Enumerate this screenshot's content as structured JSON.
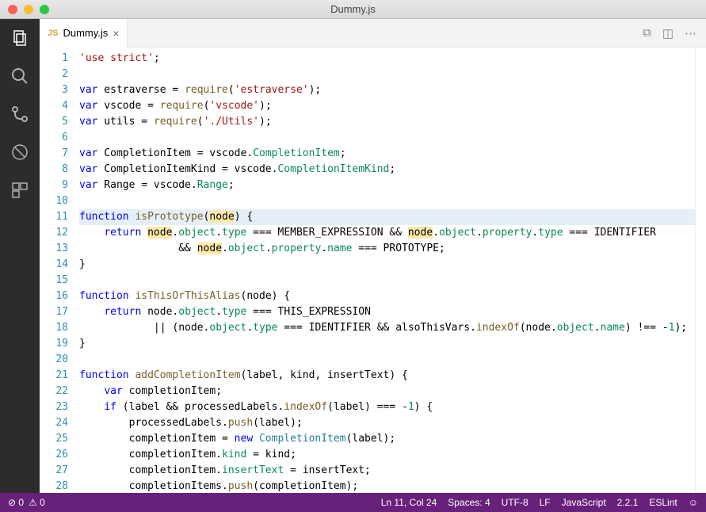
{
  "window": {
    "title": "Dummy.js"
  },
  "tab": {
    "icon": "JS",
    "name": "Dummy.js"
  },
  "code": {
    "lines": [
      [
        {
          "c": "s",
          "t": "'use strict'"
        },
        {
          "c": "",
          "t": ";"
        }
      ],
      [],
      [
        {
          "c": "k",
          "t": "var"
        },
        {
          "c": "",
          "t": " estraverse = "
        },
        {
          "c": "fn",
          "t": "require"
        },
        {
          "c": "",
          "t": "("
        },
        {
          "c": "s",
          "t": "'estraverse'"
        },
        {
          "c": "",
          "t": ");"
        }
      ],
      [
        {
          "c": "k",
          "t": "var"
        },
        {
          "c": "",
          "t": " vscode = "
        },
        {
          "c": "fn",
          "t": "require"
        },
        {
          "c": "",
          "t": "("
        },
        {
          "c": "s",
          "t": "'vscode'"
        },
        {
          "c": "",
          "t": ");"
        }
      ],
      [
        {
          "c": "k",
          "t": "var"
        },
        {
          "c": "",
          "t": " utils = "
        },
        {
          "c": "fn",
          "t": "require"
        },
        {
          "c": "",
          "t": "("
        },
        {
          "c": "s",
          "t": "'./Utils'"
        },
        {
          "c": "",
          "t": ");"
        }
      ],
      [],
      [
        {
          "c": "k",
          "t": "var"
        },
        {
          "c": "",
          "t": " CompletionItem = vscode."
        },
        {
          "c": "p",
          "t": "CompletionItem"
        },
        {
          "c": "",
          "t": ";"
        }
      ],
      [
        {
          "c": "k",
          "t": "var"
        },
        {
          "c": "",
          "t": " CompletionItemKind = vscode."
        },
        {
          "c": "p",
          "t": "CompletionItemKind"
        },
        {
          "c": "",
          "t": ";"
        }
      ],
      [
        {
          "c": "k",
          "t": "var"
        },
        {
          "c": "",
          "t": " Range = vscode."
        },
        {
          "c": "p",
          "t": "Range"
        },
        {
          "c": "",
          "t": ";"
        }
      ],
      [],
      [
        {
          "c": "k",
          "t": "function"
        },
        {
          "c": "",
          "t": " "
        },
        {
          "c": "fn",
          "t": "isPrototype"
        },
        {
          "c": "",
          "t": "("
        },
        {
          "c": "sel",
          "t": "node"
        },
        {
          "c": "",
          "t": ") {"
        }
      ],
      [
        {
          "c": "",
          "t": "    "
        },
        {
          "c": "k",
          "t": "return"
        },
        {
          "c": "",
          "t": " "
        },
        {
          "c": "sel",
          "t": "node"
        },
        {
          "c": "",
          "t": "."
        },
        {
          "c": "p",
          "t": "object"
        },
        {
          "c": "",
          "t": "."
        },
        {
          "c": "p",
          "t": "type"
        },
        {
          "c": "",
          "t": " === MEMBER_EXPRESSION && "
        },
        {
          "c": "sel",
          "t": "node"
        },
        {
          "c": "",
          "t": "."
        },
        {
          "c": "p",
          "t": "object"
        },
        {
          "c": "",
          "t": "."
        },
        {
          "c": "p",
          "t": "property"
        },
        {
          "c": "",
          "t": "."
        },
        {
          "c": "p",
          "t": "type"
        },
        {
          "c": "",
          "t": " === IDENTIFIER"
        }
      ],
      [
        {
          "c": "",
          "t": "                && "
        },
        {
          "c": "sel",
          "t": "node"
        },
        {
          "c": "",
          "t": "."
        },
        {
          "c": "p",
          "t": "object"
        },
        {
          "c": "",
          "t": "."
        },
        {
          "c": "p",
          "t": "property"
        },
        {
          "c": "",
          "t": "."
        },
        {
          "c": "p",
          "t": "name"
        },
        {
          "c": "",
          "t": " === PROTOTYPE;"
        }
      ],
      [
        {
          "c": "",
          "t": "}"
        }
      ],
      [],
      [
        {
          "c": "k",
          "t": "function"
        },
        {
          "c": "",
          "t": " "
        },
        {
          "c": "fn",
          "t": "isThisOrThisAlias"
        },
        {
          "c": "",
          "t": "(node) {"
        }
      ],
      [
        {
          "c": "",
          "t": "    "
        },
        {
          "c": "k",
          "t": "return"
        },
        {
          "c": "",
          "t": " node."
        },
        {
          "c": "p",
          "t": "object"
        },
        {
          "c": "",
          "t": "."
        },
        {
          "c": "p",
          "t": "type"
        },
        {
          "c": "",
          "t": " === THIS_EXPRESSION"
        }
      ],
      [
        {
          "c": "",
          "t": "            || (node."
        },
        {
          "c": "p",
          "t": "object"
        },
        {
          "c": "",
          "t": "."
        },
        {
          "c": "p",
          "t": "type"
        },
        {
          "c": "",
          "t": " === IDENTIFIER && alsoThisVars."
        },
        {
          "c": "fn",
          "t": "indexOf"
        },
        {
          "c": "",
          "t": "(node."
        },
        {
          "c": "p",
          "t": "object"
        },
        {
          "c": "",
          "t": "."
        },
        {
          "c": "p",
          "t": "name"
        },
        {
          "c": "",
          "t": ") !== -"
        },
        {
          "c": "p",
          "t": "1"
        },
        {
          "c": "",
          "t": ");"
        }
      ],
      [
        {
          "c": "",
          "t": "}"
        }
      ],
      [],
      [
        {
          "c": "k",
          "t": "function"
        },
        {
          "c": "",
          "t": " "
        },
        {
          "c": "fn",
          "t": "addCompletionItem"
        },
        {
          "c": "",
          "t": "(label, kind, insertText) {"
        }
      ],
      [
        {
          "c": "",
          "t": "    "
        },
        {
          "c": "k",
          "t": "var"
        },
        {
          "c": "",
          "t": " completionItem;"
        }
      ],
      [
        {
          "c": "",
          "t": "    "
        },
        {
          "c": "k",
          "t": "if"
        },
        {
          "c": "",
          "t": " (label && processedLabels."
        },
        {
          "c": "fn",
          "t": "indexOf"
        },
        {
          "c": "",
          "t": "(label) === -"
        },
        {
          "c": "p",
          "t": "1"
        },
        {
          "c": "",
          "t": ") {"
        }
      ],
      [
        {
          "c": "",
          "t": "        processedLabels."
        },
        {
          "c": "fn",
          "t": "push"
        },
        {
          "c": "",
          "t": "(label);"
        }
      ],
      [
        {
          "c": "",
          "t": "        completionItem = "
        },
        {
          "c": "k",
          "t": "new"
        },
        {
          "c": "",
          "t": " "
        },
        {
          "c": "t",
          "t": "CompletionItem"
        },
        {
          "c": "",
          "t": "(label);"
        }
      ],
      [
        {
          "c": "",
          "t": "        completionItem."
        },
        {
          "c": "p",
          "t": "kind"
        },
        {
          "c": "",
          "t": " = kind;"
        }
      ],
      [
        {
          "c": "",
          "t": "        completionItem."
        },
        {
          "c": "p",
          "t": "insertText"
        },
        {
          "c": "",
          "t": " = insertText;"
        }
      ],
      [
        {
          "c": "",
          "t": "        completionItems."
        },
        {
          "c": "fn",
          "t": "push"
        },
        {
          "c": "",
          "t": "(completionItem);"
        }
      ]
    ],
    "current_line": 11
  },
  "status": {
    "errors": "0",
    "warnings": "0",
    "cursor": "Ln 11, Col 24",
    "spaces": "Spaces: 4",
    "encoding": "UTF-8",
    "eol": "LF",
    "language": "JavaScript",
    "version": "2.2.1",
    "linter": "ESLint"
  }
}
